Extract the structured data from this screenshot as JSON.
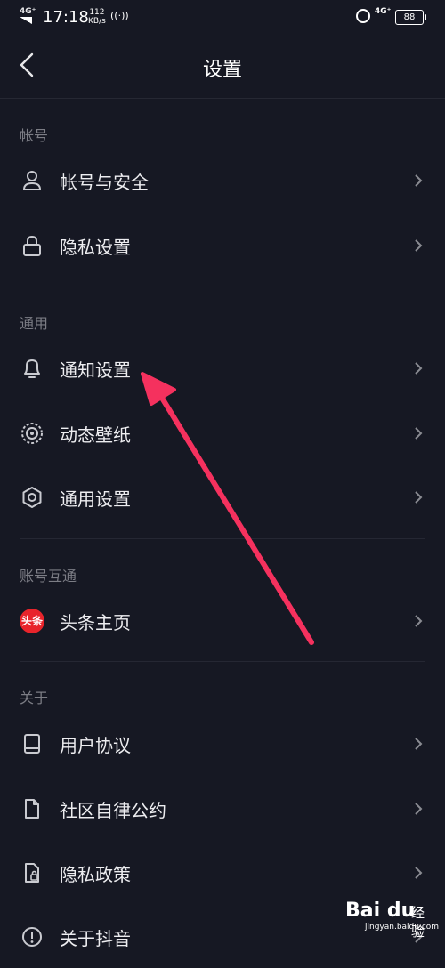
{
  "status_bar": {
    "network_left": "4G⁺",
    "time": "17:18",
    "speed_value": "112",
    "speed_unit": "KB/s",
    "network_right": "4G⁺",
    "battery": "88"
  },
  "header": {
    "title": "设置"
  },
  "sections": [
    {
      "title": "帐号",
      "items": [
        {
          "label": "帐号与安全",
          "icon": "user-icon"
        },
        {
          "label": "隐私设置",
          "icon": "lock-icon"
        }
      ]
    },
    {
      "title": "通用",
      "items": [
        {
          "label": "通知设置",
          "icon": "bell-icon"
        },
        {
          "label": "动态壁纸",
          "icon": "wallpaper-icon"
        },
        {
          "label": "通用设置",
          "icon": "gear-icon"
        }
      ]
    },
    {
      "title": "账号互通",
      "items": [
        {
          "label": "头条主页",
          "icon": "toutiao-icon",
          "badge": "头条"
        }
      ]
    },
    {
      "title": "关于",
      "items": [
        {
          "label": "用户协议",
          "icon": "book-icon"
        },
        {
          "label": "社区自律公约",
          "icon": "document-icon"
        },
        {
          "label": "隐私政策",
          "icon": "privacy-policy-icon"
        },
        {
          "label": "关于抖音",
          "icon": "info-icon"
        }
      ]
    }
  ],
  "annotation": {
    "color": "#f5315e",
    "points_to": "通知设置"
  },
  "watermark": {
    "brand": "Bai du",
    "cn": "经验",
    "url": "jingyan.baidu.com"
  },
  "colors": {
    "background": "#161823",
    "text": "#ededf0",
    "muted": "#7c7d85",
    "divider": "#252733"
  }
}
